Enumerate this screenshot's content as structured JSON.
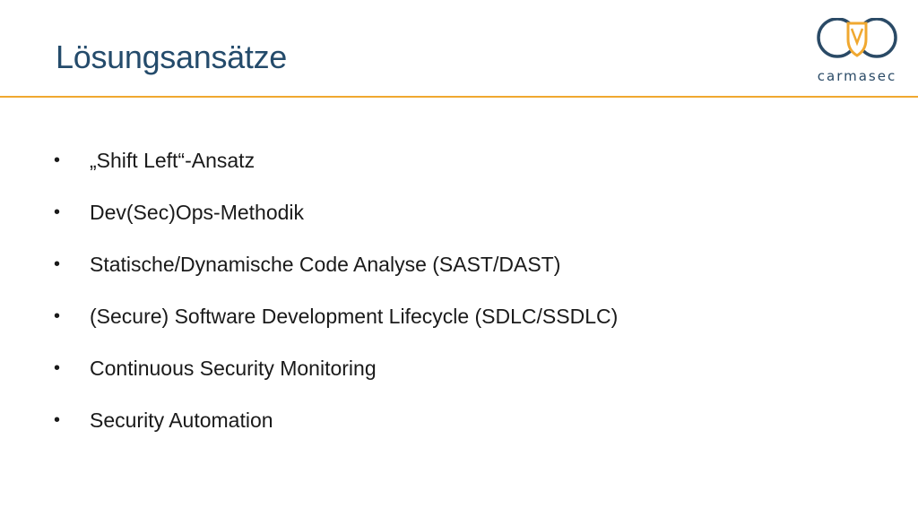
{
  "slide": {
    "title": "Lösungsansätze",
    "accent_color": "#f0a830",
    "title_color": "#244b6b"
  },
  "logo": {
    "text": "carmasec",
    "icon": "carmasec-logo-icon"
  },
  "bullets": [
    {
      "text": "„Shift Left“-Ansatz"
    },
    {
      "text": "Dev(Sec)Ops-Methodik"
    },
    {
      "text": "Statische/Dynamische Code Analyse (SAST/DAST)"
    },
    {
      "text": "(Secure) Software Development Lifecycle (SDLC/SSDLC)"
    },
    {
      "text": "Continuous Security Monitoring"
    },
    {
      "text": "Security Automation"
    }
  ],
  "bullet_symbol": "•"
}
